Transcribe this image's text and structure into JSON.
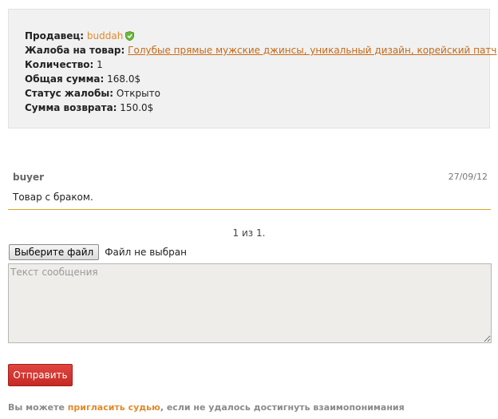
{
  "complaint": {
    "seller_label": "Продавец:",
    "seller_name": "buddah",
    "seller_badge_icon": "shield-check-icon",
    "product_label": "Жалоба на товар:",
    "product_name": "Голубые прямые мужские джинсы, уникальный дизайн, корейский патч",
    "quantity_label": "Количество:",
    "quantity_value": "1",
    "total_label": "Общая сумма:",
    "total_value": "168.0$",
    "status_label": "Статус жалобы:",
    "status_value": "Открыто",
    "refund_label": "Сумма возврата:",
    "refund_value": "150.0$"
  },
  "messages": [
    {
      "author": "buyer",
      "date": "27/09/12",
      "text": "Товар с браком."
    }
  ],
  "pagination": {
    "text": "1 из 1."
  },
  "reply_form": {
    "file_button_label": "Выберите файл",
    "file_status": "Файл не выбран",
    "message_placeholder": "Текст сообщения",
    "submit_label": "Отправить"
  },
  "footer": {
    "prefix": "Вы можете ",
    "link_text": "пригласить судью",
    "suffix": ", если не удалось достигнуть взаимопонимания"
  },
  "colors": {
    "accent_link": "#e08a2c",
    "submit_button": "#d2352f",
    "message_divider": "#e0a020"
  }
}
